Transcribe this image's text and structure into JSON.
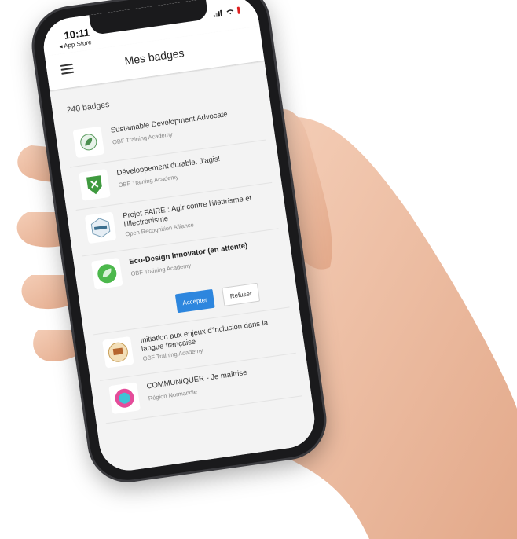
{
  "status_bar": {
    "time": "10:11",
    "back_app": "◂ App Store"
  },
  "nav": {
    "title": "Mes badges"
  },
  "badges_count": "240 badges",
  "badges": [
    {
      "title": "Sustainable Development Advocate",
      "issuer": "OBF Training Academy",
      "icon": "leaf-badge-icon",
      "pending": false
    },
    {
      "title": "Développement durable: J'agis!",
      "issuer": "OBF Training Academy",
      "icon": "shield-badge-icon",
      "pending": false
    },
    {
      "title": "Projet FAIRE : Agir contre l'illettrisme et l'illectronisme",
      "issuer": "Open Recognition Alliance",
      "icon": "hexagon-badge-icon",
      "pending": false
    },
    {
      "title": "Eco-Design Innovator (en attente)",
      "issuer": "OBF Training Academy",
      "icon": "eco-design-badge-icon",
      "pending": true
    },
    {
      "title": "Initiation aux enjeux d'inclusion dans la langue française",
      "issuer": "OBF Training Academy",
      "icon": "round-badge-icon",
      "pending": false
    },
    {
      "title": "COMMUNIQUER - Je maîtrise",
      "issuer": "Région Normandie",
      "icon": "communiquer-badge-icon",
      "pending": false
    }
  ],
  "actions": {
    "accept_label": "Accepter",
    "refuse_label": "Refuser"
  },
  "colors": {
    "accent": "#2d86de",
    "battery": "#e02020"
  }
}
